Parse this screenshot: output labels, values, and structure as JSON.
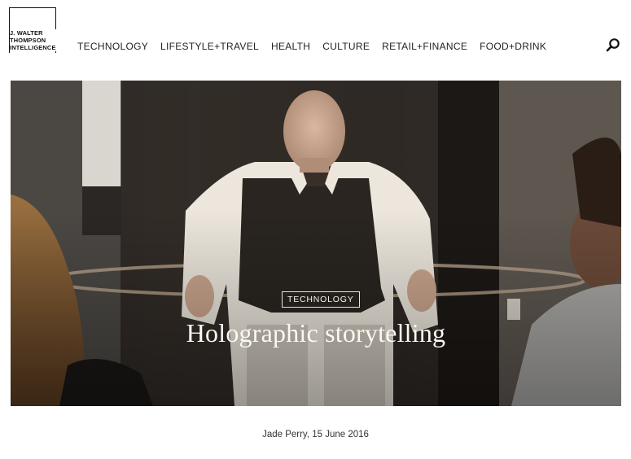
{
  "brand": {
    "lines": [
      "J. WALTER",
      "THOMPSON",
      "INTELLIGENCE"
    ]
  },
  "nav": {
    "items": [
      "TECHNOLOGY",
      "LIFESTYLE+TRAVEL",
      "HEALTH",
      "CULTURE",
      "RETAIL+FINANCE",
      "FOOD+DRINK"
    ]
  },
  "search": {
    "icon": "search-icon"
  },
  "hero": {
    "category": "TECHNOLOGY",
    "title": "Holographic storytelling"
  },
  "article": {
    "byline": "Jade Perry, 15 June 2016"
  },
  "colors": {
    "text": "#111111",
    "hero_text": "#fbf8f2"
  }
}
